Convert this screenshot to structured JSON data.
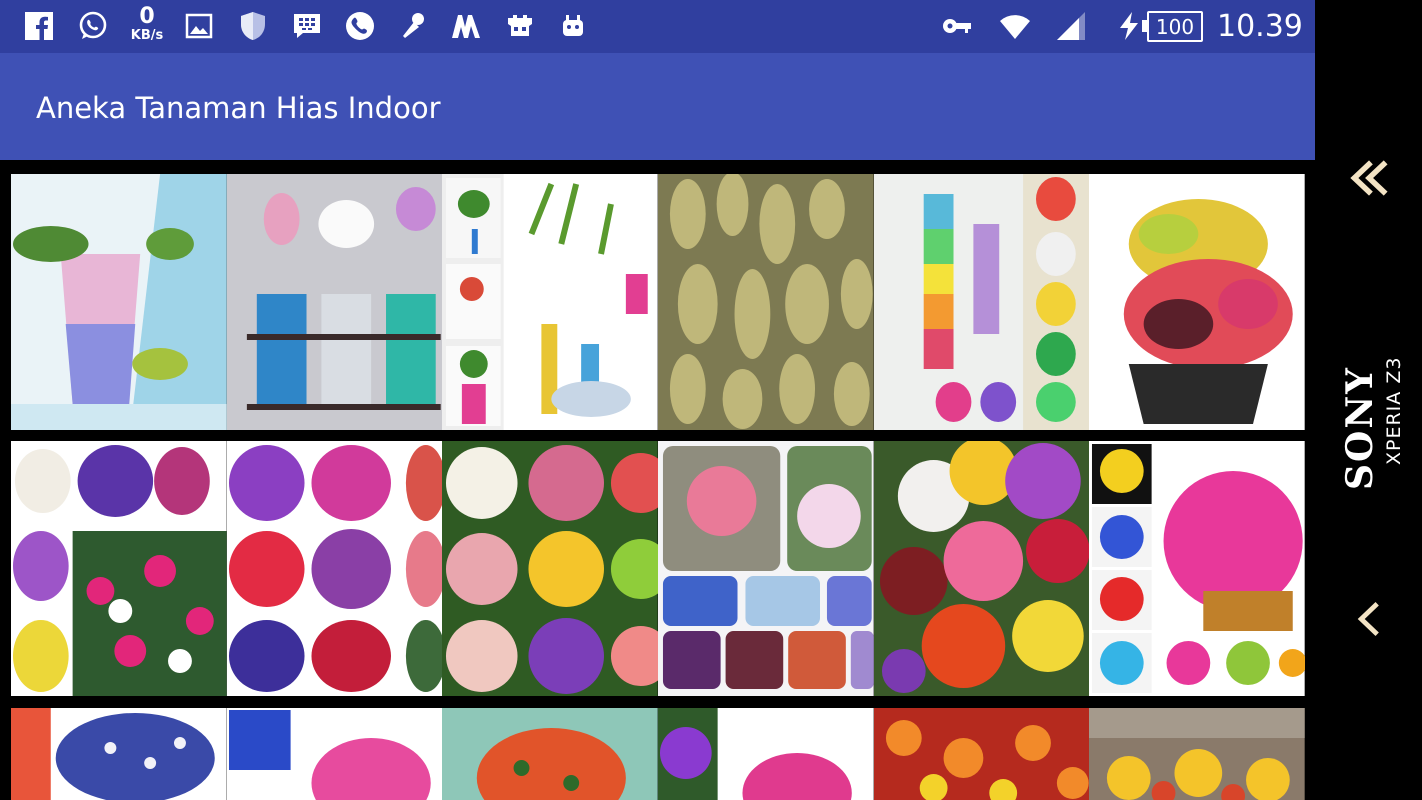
{
  "status_bar": {
    "net_speed_value": "0",
    "net_speed_unit": "KB/s",
    "battery": "100",
    "time": "10.39",
    "left_icons": [
      "facebook-icon",
      "whatsapp-icon",
      "net-speed",
      "gallery-icon",
      "shield-icon",
      "bbm-icon",
      "phone-icon",
      "microphone-icon",
      "m-logo-icon",
      "game-icon",
      "android-icon"
    ],
    "right_icons": [
      "vpn-key-icon",
      "wifi-icon",
      "signal-icon",
      "charging-icon",
      "battery-icon"
    ]
  },
  "app_bar": {
    "title": "Aneka Tanaman Hias Indoor"
  },
  "colors": {
    "status_bar": "#303f9f",
    "app_bar": "#3f51b5",
    "background": "#000000"
  },
  "grid": {
    "rows": [
      [
        "water-beads-vase",
        "tulip-bead-vases",
        "bamboo-bead-vases",
        "cactus",
        "rainbow-bead-vases",
        "croton-plant"
      ],
      [
        "petunia-collage",
        "carnation-collage",
        "zinnia-collage",
        "columbine-collage",
        "dahlia-bouquet",
        "orchid-collage"
      ],
      [
        "cineraria-collage",
        "pink-flower-pot",
        "impatiens-basket",
        "purple-pink-flowers",
        "zinnia-field",
        "primrose-bed"
      ]
    ]
  },
  "device": {
    "brand": "SONY",
    "model": "XPERIA Z3"
  },
  "nav": {
    "icons": [
      "double-chevron-left-icon",
      "chevron-left-icon"
    ]
  }
}
